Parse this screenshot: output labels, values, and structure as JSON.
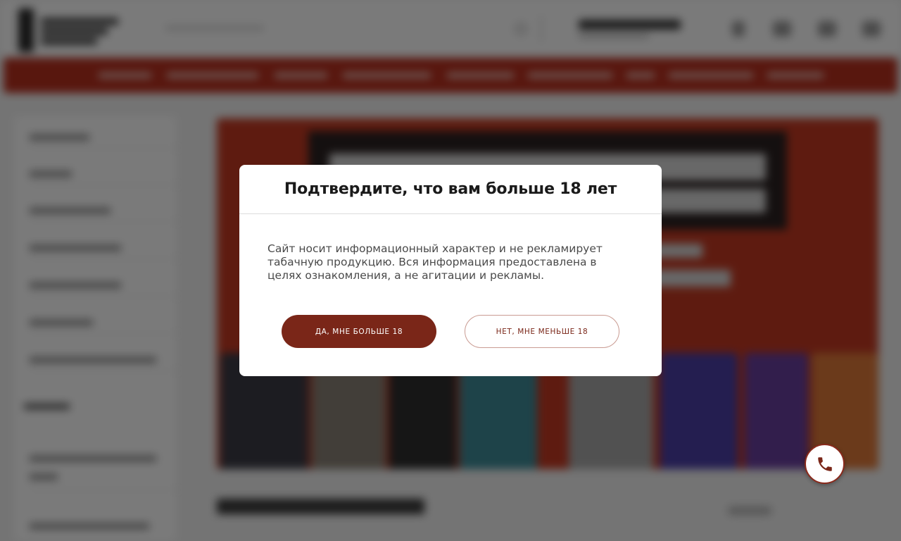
{
  "age_modal": {
    "title": "Подтвердите, что вам больше 18 лет",
    "message": "Сайт носит информационный характер и не рекламирует табачную продукцию. Вся информация предоставлена в целях ознакомления, а не агитации и рекламы.",
    "confirm_label": "ДА, МНЕ БОЛЬШЕ 18",
    "decline_label": "НЕТ, МНЕ МЕНЬШЕ 18"
  },
  "floating": {
    "call_icon": "phone-icon"
  },
  "colors": {
    "accent": "#7a2618",
    "nav_background": "#b9301f",
    "overlay": "rgba(0,0,0,0.52)"
  }
}
